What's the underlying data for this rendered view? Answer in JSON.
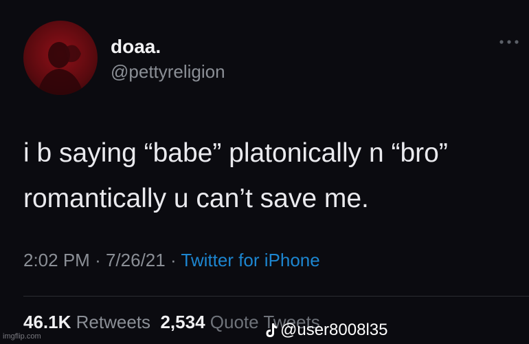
{
  "tweet": {
    "author": {
      "display_name": "doaa.",
      "handle": "@pettyreligion",
      "avatar_icon": "profile-photo"
    },
    "more_icon": "more-dots-icon",
    "text_lines": [
      "i b saying “babe” platonically n “bro”",
      "romantically  u can’t save me."
    ],
    "meta": {
      "time": "2:02 PM",
      "separator": "·",
      "date": "7/26/21",
      "source": "Twitter for iPhone"
    },
    "stats": {
      "retweets_count": "46.1K",
      "retweets_label": "Retweets",
      "quotes_count": "2,534",
      "quotes_label": "Quote Tweets"
    }
  },
  "overlay": {
    "tiktok_icon": "tiktok-icon",
    "tiktok_user": "@user8008l35"
  },
  "watermark": "imgflip.com",
  "colors": {
    "background": "#0b0b10",
    "link": "#1d86d0",
    "secondary_text": "#8b8f96",
    "avatar": "#8f1018"
  }
}
